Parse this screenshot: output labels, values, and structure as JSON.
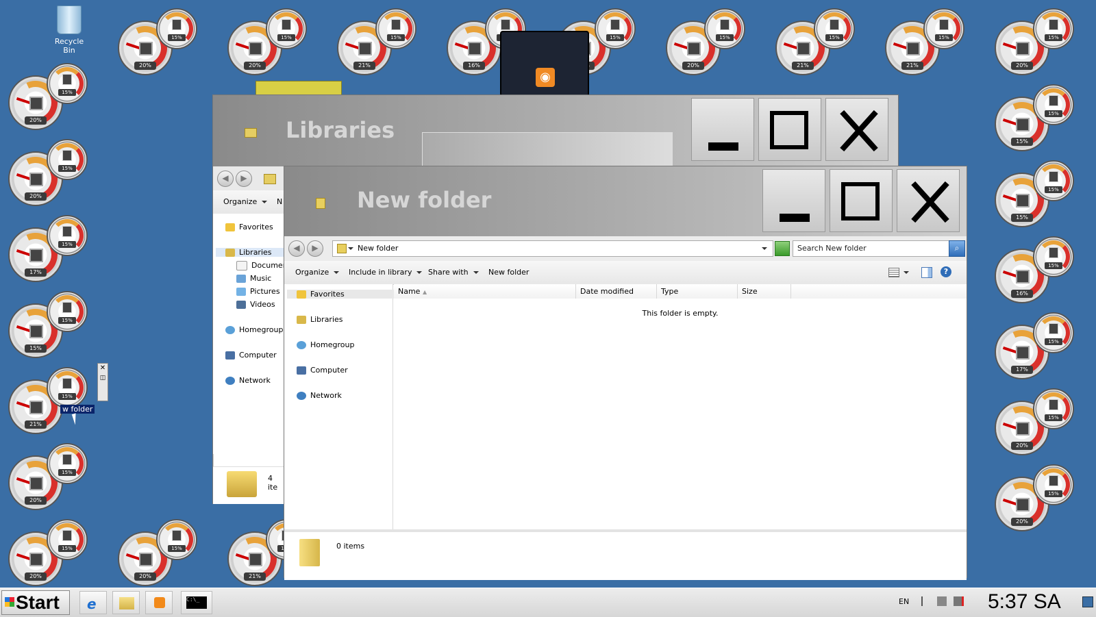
{
  "desktop": {
    "recycle_bin_label": "Recycle Bin",
    "selected_icon_label": "w folder",
    "gadgets": [
      {
        "big": "20%",
        "small": "15%"
      },
      {
        "big": "20%",
        "small": "15%"
      },
      {
        "big": "21%",
        "small": "15%"
      },
      {
        "big": "16%",
        "small": "15%"
      },
      {
        "big": "20%",
        "small": "15%"
      },
      {
        "big": "20%",
        "small": "15%"
      },
      {
        "big": "21%",
        "small": "15%"
      },
      {
        "big": "21%",
        "small": "15%"
      },
      {
        "big": "20%",
        "small": "15%"
      },
      {
        "big": "20%",
        "small": "15%"
      },
      {
        "big": "20%",
        "small": "15%"
      },
      {
        "big": "17%",
        "small": "15%"
      },
      {
        "big": "15%",
        "small": "15%"
      },
      {
        "big": "21%",
        "small": "15%"
      },
      {
        "big": "20%",
        "small": "15%"
      },
      {
        "big": "20%",
        "small": "15%"
      },
      {
        "big": "20%",
        "small": "15%"
      },
      {
        "big": "21%",
        "small": "15%"
      },
      {
        "big": "15%",
        "small": "15%"
      },
      {
        "big": "15%",
        "small": "15%"
      },
      {
        "big": "16%",
        "small": "15%"
      },
      {
        "big": "17%",
        "small": "15%"
      },
      {
        "big": "20%",
        "small": "15%"
      },
      {
        "big": "20%",
        "small": "15%"
      }
    ]
  },
  "libraries_window": {
    "title": "Libraries",
    "organize": "Organize",
    "toolbar_partial": "N",
    "nav": {
      "favorites": "Favorites",
      "libraries": "Libraries",
      "documents": "Document",
      "music": "Music",
      "pictures": "Pictures",
      "videos": "Videos",
      "homegroup": "Homegroup",
      "computer": "Computer",
      "network": "Network"
    },
    "status": "4 ite"
  },
  "newfolder_window": {
    "title": "New folder",
    "address": "New folder",
    "search_placeholder": "Search New folder",
    "toolbar": {
      "organize": "Organize",
      "include": "Include in library",
      "share": "Share with",
      "new_folder": "New folder"
    },
    "columns": [
      "Name",
      "Date modified",
      "Type",
      "Size"
    ],
    "empty_message": "This folder is empty.",
    "nav": {
      "favorites": "Favorites",
      "libraries": "Libraries",
      "homegroup": "Homegroup",
      "computer": "Computer",
      "network": "Network"
    },
    "status": "0 items"
  },
  "taskbar": {
    "start_label": "Start",
    "language": "EN",
    "clock": "5:37 SA"
  },
  "colors": {
    "desktop": "#3a6ea5",
    "titlebar_text": "#d6d6d6",
    "selection": "#0a246a"
  }
}
